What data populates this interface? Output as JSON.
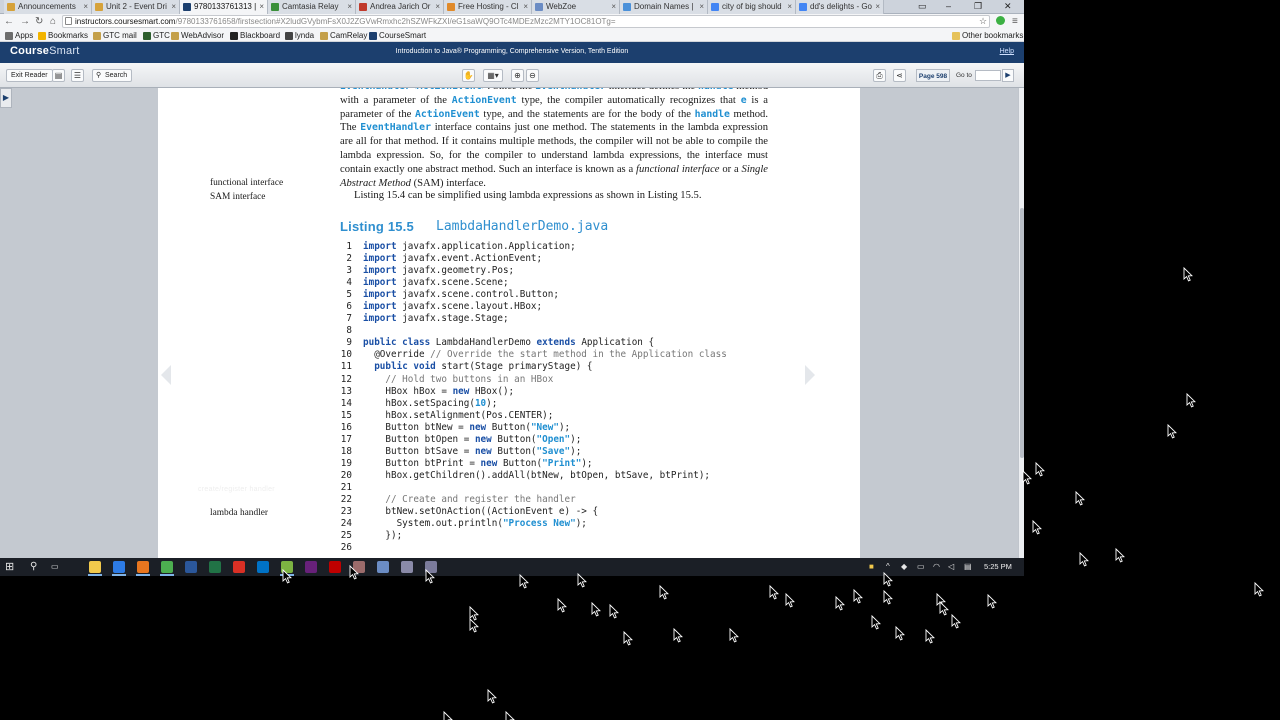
{
  "browser": {
    "tabs": [
      {
        "label": "Announcements",
        "color": "#d6a23a",
        "active": false
      },
      {
        "label": "Unit 2 - Event Dri",
        "color": "#d6a23a",
        "active": false
      },
      {
        "label": "9780133761313 |",
        "color": "#1c3f6e",
        "active": true
      },
      {
        "label": "Camtasia Relay",
        "color": "#3a8f3a",
        "active": false
      },
      {
        "label": "Andrea Jarich Or",
        "color": "#c0392b",
        "active": false
      },
      {
        "label": "Free Hosting - Cl",
        "color": "#e08a2a",
        "active": false
      },
      {
        "label": "WebZoe",
        "color": "#6b8cc4",
        "active": false
      },
      {
        "label": "Domain Names |",
        "color": "#4a90d9",
        "active": false
      },
      {
        "label": "city of big should",
        "color": "#4285f4",
        "active": false
      },
      {
        "label": "dd's delights - Go",
        "color": "#4285f4",
        "active": false
      }
    ],
    "url_host": "instructors.coursesmart.com",
    "url_path": "/9780133761658/firstsection#X2ludGVybmFsX0J2ZGVwRmxhc2hSZWFkZXI/eG1saWQ9OTc4MDEzMzc2MTY1OC81OTg="
  },
  "bookmarks": [
    {
      "label": "Apps",
      "color": "#6d6d6d"
    },
    {
      "label": "Bookmarks",
      "color": "#f2b400"
    },
    {
      "label": "GTC mail",
      "color": "#c4a04a"
    },
    {
      "label": "GTC",
      "color": "#2d5e2d"
    },
    {
      "label": "WebAdvisor",
      "color": "#c4a04a"
    },
    {
      "label": "Blackboard",
      "color": "#222222"
    },
    {
      "label": "lynda",
      "color": "#444444"
    },
    {
      "label": "CamRelay",
      "color": "#c4a04a"
    },
    {
      "label": "CourseSmart",
      "color": "#1c3f6e"
    }
  ],
  "other_bookmarks": "Other bookmarks",
  "coursesmart": {
    "logo_bold": "Course",
    "logo_light": "Smart",
    "title": "Introduction to Java® Programming, Comprehensive Version, Tenth Edition",
    "help": "Help"
  },
  "toolbar": {
    "exit_reader": "Exit Reader",
    "search": "Search",
    "page_label": "Page 598",
    "goto_label": "Go to"
  },
  "book": {
    "para_pre": "method with a parameter of the ",
    "margin_functional": "functional interface",
    "margin_sam": "SAM interface",
    "margin_lambda": "lambda handler",
    "ref_line": "Listing 15.4 can be simplified using lambda expressions as shown in Listing 15.5.",
    "listing_label": "Listing 15.5",
    "listing_name": "LambdaHandlerDemo.java",
    "faint": "create/register handler"
  },
  "code_lines": [
    {
      "n": "1",
      "html": "<span class=\"kw\">import</span> javafx.application.Application;"
    },
    {
      "n": "2",
      "html": "<span class=\"kw\">import</span> javafx.event.ActionEvent;"
    },
    {
      "n": "3",
      "html": "<span class=\"kw\">import</span> javafx.geometry.Pos;"
    },
    {
      "n": "4",
      "html": "<span class=\"kw\">import</span> javafx.scene.Scene;"
    },
    {
      "n": "5",
      "html": "<span class=\"kw\">import</span> javafx.scene.control.Button;"
    },
    {
      "n": "6",
      "html": "<span class=\"kw\">import</span> javafx.scene.layout.HBox;"
    },
    {
      "n": "7",
      "html": "<span class=\"kw\">import</span> javafx.stage.Stage;"
    },
    {
      "n": "8",
      "html": ""
    },
    {
      "n": "9",
      "html": "<span class=\"kw\">public class</span> LambdaHandlerDemo <span class=\"kw\">extends</span> Application {"
    },
    {
      "n": "10",
      "html": "  @Override <span class=\"cm\">// Override the start method in the Application class</span>"
    },
    {
      "n": "11",
      "html": "  <span class=\"kw\">public void</span> start(Stage primaryStage) {"
    },
    {
      "n": "12",
      "html": "    <span class=\"cm\">// Hold two buttons in an HBox</span>"
    },
    {
      "n": "13",
      "html": "    HBox hBox = <span class=\"kw\">new</span> HBox();"
    },
    {
      "n": "14",
      "html": "    hBox.setSpacing(<span class=\"str\">10</span>);"
    },
    {
      "n": "15",
      "html": "    hBox.setAlignment(Pos.CENTER);"
    },
    {
      "n": "16",
      "html": "    Button btNew = <span class=\"kw\">new</span> Button(<span class=\"str\">\"New\"</span>);"
    },
    {
      "n": "17",
      "html": "    Button btOpen = <span class=\"kw\">new</span> Button(<span class=\"str\">\"Open\"</span>);"
    },
    {
      "n": "18",
      "html": "    Button btSave = <span class=\"kw\">new</span> Button(<span class=\"str\">\"Save\"</span>);"
    },
    {
      "n": "19",
      "html": "    Button btPrint = <span class=\"kw\">new</span> Button(<span class=\"str\">\"Print\"</span>);"
    },
    {
      "n": "20",
      "html": "    hBox.getChildren().addAll(btNew, btOpen, btSave, btPrint);"
    },
    {
      "n": "21",
      "html": ""
    },
    {
      "n": "22",
      "html": "    <span class=\"cm\">// Create and register the handler</span>"
    },
    {
      "n": "23",
      "html": "    btNew.setOnAction((ActionEvent e) -&gt; {"
    },
    {
      "n": "24",
      "html": "      System.out.println(<span class=\"str\">\"Process New\"</span>);"
    },
    {
      "n": "25",
      "html": "    });"
    },
    {
      "n": "26",
      "html": ""
    }
  ],
  "taskbar": {
    "clock": "5:25 PM",
    "apps": [
      {
        "icon": "file-explorer-icon",
        "color": "#f2c94c"
      },
      {
        "icon": "edge-icon",
        "color": "#2d7be5"
      },
      {
        "icon": "firefox-icon",
        "color": "#e8761f"
      },
      {
        "icon": "chrome-icon",
        "color": "#4caf50"
      },
      {
        "icon": "word-icon",
        "color": "#2b579a"
      },
      {
        "icon": "excel-icon",
        "color": "#217346"
      },
      {
        "icon": "acrobat-icon",
        "color": "#d93025"
      },
      {
        "icon": "outlook-icon",
        "color": "#0072c6"
      },
      {
        "icon": "notepad-plus-icon",
        "color": "#7cb342"
      },
      {
        "icon": "visual-studio-icon",
        "color": "#68217a"
      },
      {
        "icon": "filezilla-icon",
        "color": "#bf0000"
      },
      {
        "icon": "app-icon",
        "color": "#9b6b6b"
      },
      {
        "icon": "globe-icon",
        "color": "#6b8cc4"
      },
      {
        "icon": "media-icon",
        "color": "#8a8aa8"
      },
      {
        "icon": "app2-icon",
        "color": "#7b7b9b"
      }
    ]
  }
}
